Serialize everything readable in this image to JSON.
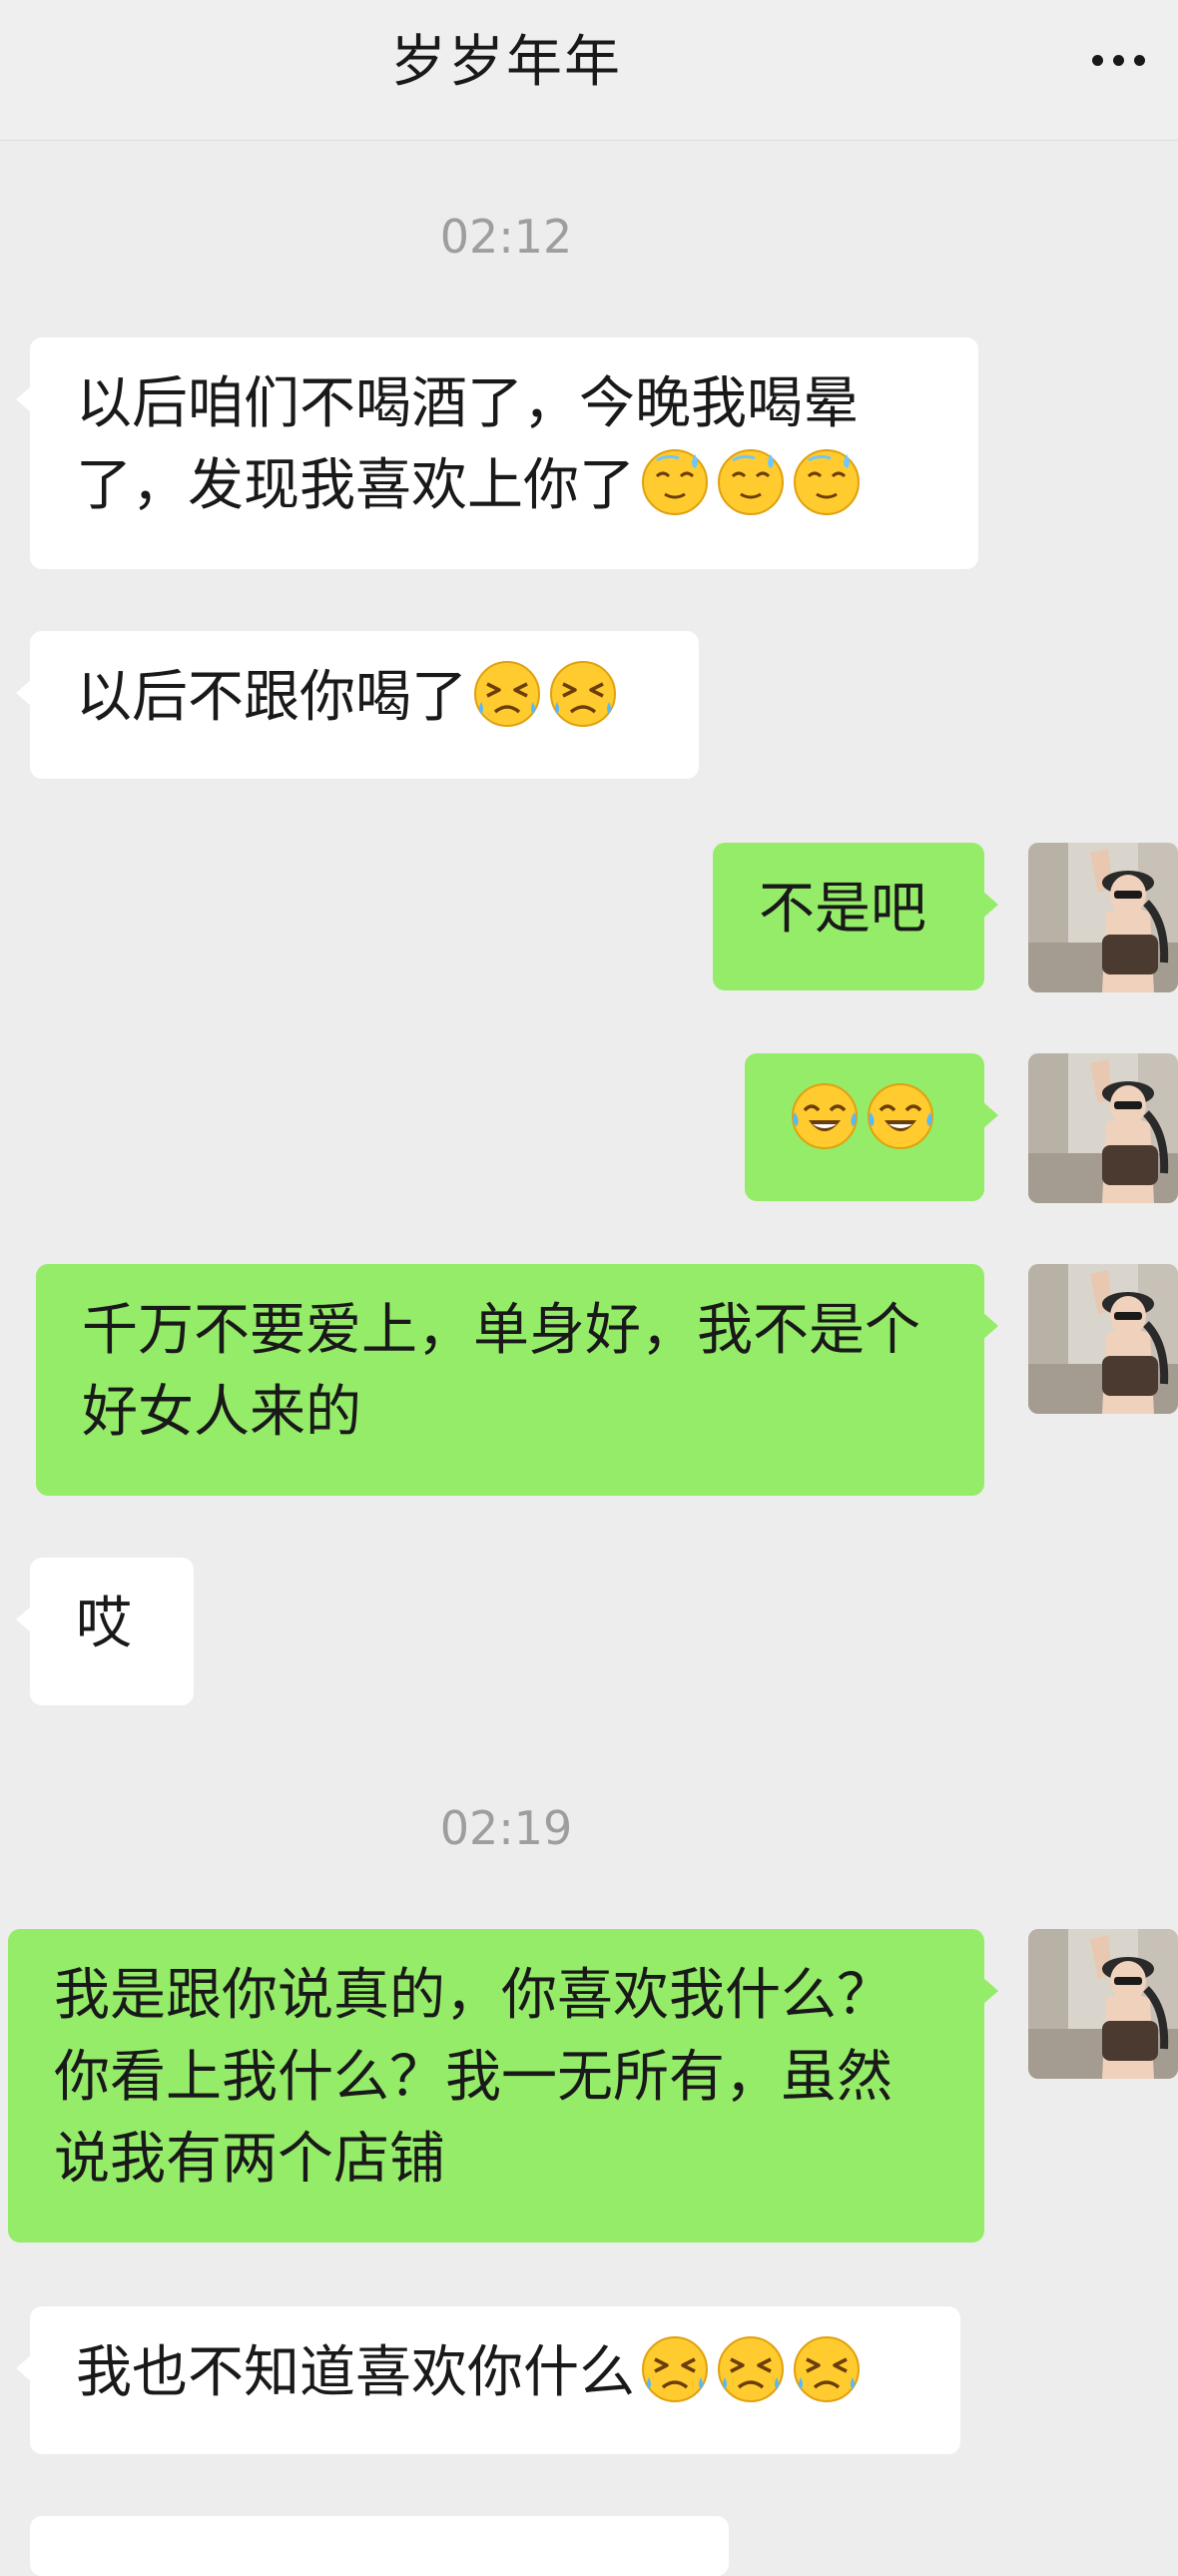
{
  "header": {
    "title": "岁岁年年",
    "more_icon": "more-dots-icon"
  },
  "timestamps": [
    "02:12",
    "02:19"
  ],
  "messages": [
    {
      "side": "in",
      "text": "以后咱们不喝酒了，今晚我喝晕了，发现我喜欢上你了",
      "emoji": [
        "sweat-dizzy-emoji",
        "sweat-dizzy-emoji",
        "sweat-dizzy-emoji"
      ]
    },
    {
      "side": "in",
      "text": "以后不跟你喝了",
      "emoji": [
        "crying-squint-emoji",
        "crying-squint-emoji"
      ]
    },
    {
      "side": "out",
      "text": "不是吧",
      "emoji": []
    },
    {
      "side": "out",
      "text": "",
      "emoji": [
        "tears-of-joy-emoji",
        "tears-of-joy-emoji"
      ]
    },
    {
      "side": "out",
      "text": "千万不要爱上，单身好，我不是个好女人来的",
      "emoji": []
    },
    {
      "side": "in",
      "text": "哎",
      "emoji": []
    },
    {
      "side": "out",
      "text": "我是跟你说真的，你喜欢我什么？你看上我什么？我一无所有，虽然说我有两个店铺",
      "emoji": []
    },
    {
      "side": "in",
      "text": "我也不知道喜欢你什么",
      "emoji": [
        "crying-squint-emoji",
        "crying-squint-emoji",
        "crying-squint-emoji"
      ]
    }
  ],
  "colors": {
    "background": "#EDEDED",
    "incoming_bubble": "#FFFFFF",
    "outgoing_bubble": "#95EC69",
    "timestamp": "#9E9E9E"
  }
}
